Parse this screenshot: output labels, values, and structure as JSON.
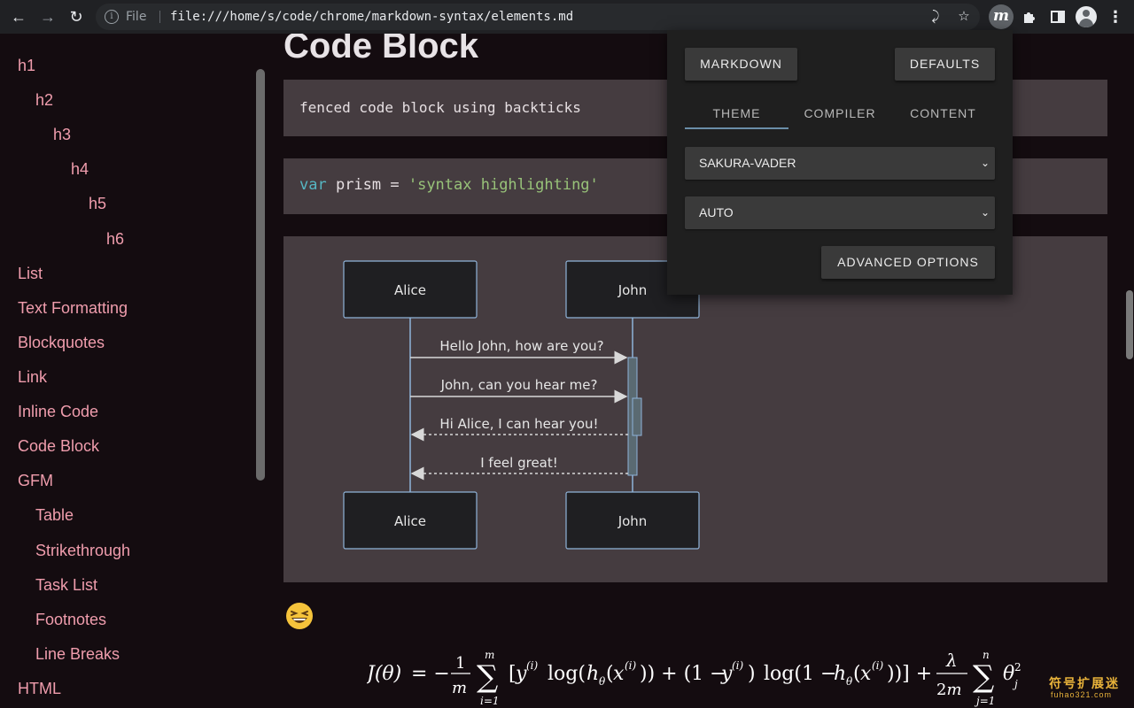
{
  "browser": {
    "scheme_label": "File",
    "url": "file:///home/s/code/chrome/markdown-syntax/elements.md",
    "extension_letter": "m"
  },
  "sidebar": {
    "items": [
      {
        "label": "h1"
      },
      {
        "label": "h2"
      },
      {
        "label": "h3"
      },
      {
        "label": "h4"
      },
      {
        "label": "h5"
      },
      {
        "label": "h6"
      },
      {
        "label": "List"
      },
      {
        "label": "Text Formatting"
      },
      {
        "label": "Blockquotes"
      },
      {
        "label": "Link"
      },
      {
        "label": "Inline Code"
      },
      {
        "label": "Code Block"
      },
      {
        "label": "GFM"
      },
      {
        "label": "Table"
      },
      {
        "label": "Strikethrough"
      },
      {
        "label": "Task List"
      },
      {
        "label": "Footnotes"
      },
      {
        "label": "Line Breaks"
      },
      {
        "label": "HTML"
      }
    ]
  },
  "content": {
    "heading": "Code Block",
    "code1": "fenced code block using backticks",
    "code2": {
      "keyword": "var",
      "middle": " prism = ",
      "string": "'syntax highlighting'"
    },
    "diagram": {
      "actor_a": "Alice",
      "actor_b": "John",
      "messages": [
        "Hello John, how are you?",
        "John, can you hear me?",
        "Hi Alice, I can hear you!",
        "I feel great!"
      ]
    },
    "emoji": "grinning-squinting-face"
  },
  "popup": {
    "markdown_button": "MARKDOWN",
    "defaults_button": "DEFAULTS",
    "tabs": [
      "THEME",
      "COMPILER",
      "CONTENT"
    ],
    "active_tab": "THEME",
    "theme_select": "SAKURA-VADER",
    "mode_select": "AUTO",
    "advanced_button": "ADVANCED OPTIONS"
  },
  "watermark": {
    "text": "符号扩展迷",
    "domain": "fuhao321.com"
  }
}
